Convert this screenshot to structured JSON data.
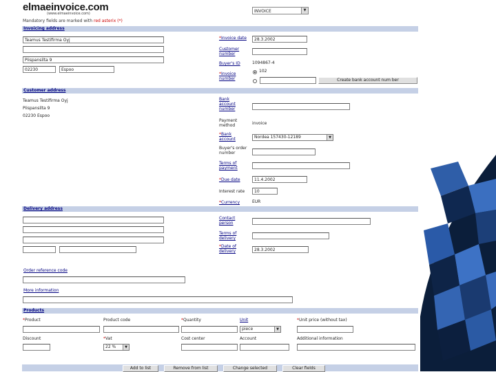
{
  "header": {
    "logo": "elmaeinvoice.com",
    "logo_sub": "(www.elmaeinvoice.com)",
    "doc_type": "INVOICE",
    "mandatory_prefix": "Mandatory fields are marked with ",
    "mandatory_red": "red asterix (*)"
  },
  "invoicing_address": {
    "section_title": "Invoicing address",
    "name1": "Teamus Testifirma Oyj",
    "name2": "",
    "street": "Piispansilta 9",
    "postal": "02230",
    "city": "Espoo"
  },
  "invoice_info": {
    "invoice_date_label": "Invoice date",
    "invoice_date": "28.3.2002",
    "customer_number_label": "Customer number",
    "customer_number": "",
    "buyers_id_label": "Buyer's ID",
    "buyers_id": "1094867-4",
    "invoice_number_label": "Invoice number",
    "invoice_number_option1": "102",
    "invoice_number_value": "",
    "create_button": "Create bank account num ber"
  },
  "customer_address": {
    "section_title": "Customer address",
    "line1": "Teamus Testifirma Oyj",
    "line2": "Piispansilta 9",
    "line3": "02230 Espoo"
  },
  "payment": {
    "bank_account_label": "Bank account number",
    "bank_account_number": "",
    "payment_method_label": "Payment method",
    "payment_method": "invoice",
    "bank_account_select_label": "Bank account",
    "bank_account_selected": "Nordea 157430-12189",
    "buyers_order_label": "Buyer's order number",
    "buyers_order": "",
    "terms_label": "Terms of payment",
    "terms": "",
    "due_date_label": "Due date",
    "due_date": "11.4.2002",
    "interest_label": "Interest rate",
    "interest": "10",
    "currency_label": "Currency",
    "currency": "EUR"
  },
  "delivery": {
    "section_title": "Delivery address",
    "contact_label": "Contact person",
    "terms_label": "Terms of delivery",
    "date_label": "Date of delivery",
    "date": "28.3.2002"
  },
  "order_ref": {
    "label": "Order reference code"
  },
  "more_info": {
    "label": "More information"
  },
  "products": {
    "section_title": "Products",
    "product_label": "Product",
    "product_code_label": "Product code",
    "quantity_label": "Quantity",
    "unit_label": "Unit",
    "unit_selected": "piece",
    "unit_price_label": "Unit price (without tax)",
    "discount_label": "Discount",
    "vat_label": "Vat",
    "vat_selected": "22 %",
    "cost_center_label": "Cost center",
    "account_label": "Account",
    "additional_label": "Additional information"
  },
  "actions": {
    "add": "Add to list",
    "remove": "Remove from list",
    "change": "Change selected",
    "clear": "Clear fields"
  },
  "colors": {
    "band": "#c5d0e6",
    "link": "#000080",
    "required": "#cc0000"
  }
}
